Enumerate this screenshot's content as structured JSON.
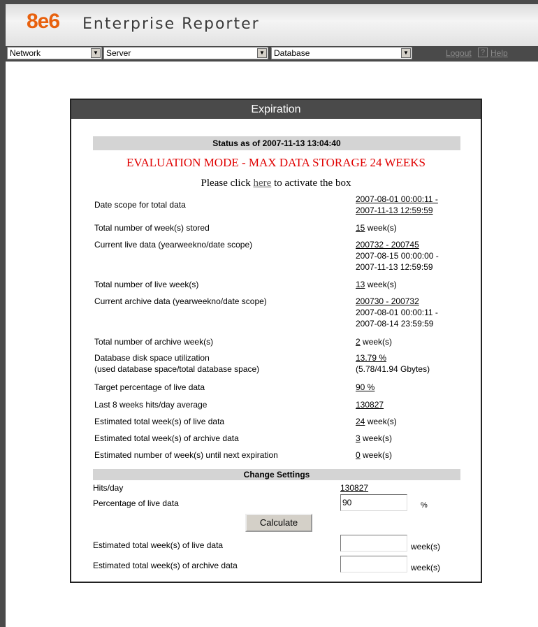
{
  "header": {
    "logo": "8e6",
    "product": "Enterprise Reporter"
  },
  "nav": {
    "network": "Network",
    "server": "Server",
    "database": "Database",
    "logout": "Logout",
    "help_box": "?",
    "help": "Help"
  },
  "panel": {
    "title": "Expiration",
    "status": "Status as of 2007-11-13 13:04:40",
    "eval_mode": "EVALUATION MODE - MAX DATA STORAGE 24 WEEKS",
    "activate_pre": "Please click ",
    "activate_link": "here",
    "activate_post": " to activate the box"
  },
  "rows": [
    {
      "label": "Date scope for total data",
      "v1": "2007-08-01 00:00:11 -",
      "v2": "2007-11-13 12:59:59"
    },
    {
      "label": "Total number of week(s) stored",
      "link": "15",
      "suffix": " week(s)"
    },
    {
      "label": "Current live data (yearweekno/date scope)",
      "link": "200732 - 200745",
      "l2": "2007-08-15 00:00:00 -",
      "l3": "2007-11-13 12:59:59"
    },
    {
      "label": "Total number of live week(s)",
      "link": "13",
      "suffix": " week(s)"
    },
    {
      "label": "Current archive data (yearweekno/date scope)",
      "link": "200730 - 200732",
      "l2": "2007-08-01 00:00:11 -",
      "l3": "2007-08-14 23:59:59"
    },
    {
      "label": "Total number of archive week(s)",
      "link": "2",
      "suffix": " week(s)"
    },
    {
      "label": "Database disk space utilization",
      "label2": "(used database space/total database space)",
      "link": "13.79 %",
      "l2": "(5.78/41.94 Gbytes)"
    },
    {
      "label": "Target percentage of live data",
      "link": "90 %"
    },
    {
      "label": "Last 8 weeks hits/day average",
      "link": "130827"
    },
    {
      "label": "Estimated total week(s) of live data",
      "link": "24",
      "suffix": " week(s)"
    },
    {
      "label": "Estimated total week(s) of archive data",
      "link": "3",
      "suffix": " week(s)"
    },
    {
      "label": "Estimated number of week(s) until next expiration",
      "link": "0",
      "suffix": " week(s)"
    }
  ],
  "change": {
    "title": "Change Settings",
    "hits_label": "Hits/day",
    "hits_value": "130827",
    "pct_label": "Percentage of live data",
    "pct_value": "90",
    "pct_unit": "%",
    "calculate": "Calculate",
    "live_label": "Estimated total week(s) of live data",
    "live_unit": "week(s)",
    "archive_label": "Estimated total week(s) of archive data",
    "archive_unit": "week(s)"
  }
}
